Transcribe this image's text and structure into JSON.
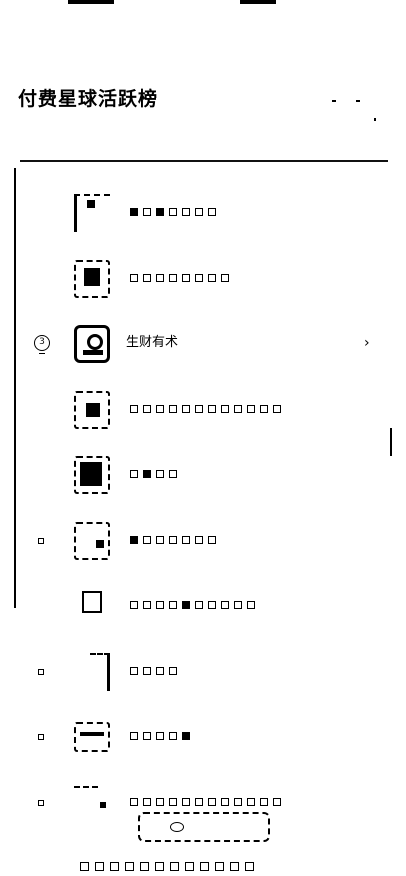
{
  "section": {
    "title": "付费星球活跃榜"
  },
  "rows": [
    {
      "rank": "",
      "name": ""
    },
    {
      "rank": "",
      "name": ""
    },
    {
      "rank": "3",
      "name": "生财有术",
      "chevron": "›"
    },
    {
      "rank": "",
      "name": ""
    },
    {
      "rank": "",
      "name": ""
    },
    {
      "rank": "",
      "name": ""
    },
    {
      "rank": "",
      "name": ""
    },
    {
      "rank": "",
      "name": ""
    },
    {
      "rank": "",
      "name": ""
    },
    {
      "rank": "",
      "name": ""
    }
  ],
  "icons": {
    "medal": "medal-icon",
    "chevron": "chevron-right-icon"
  }
}
